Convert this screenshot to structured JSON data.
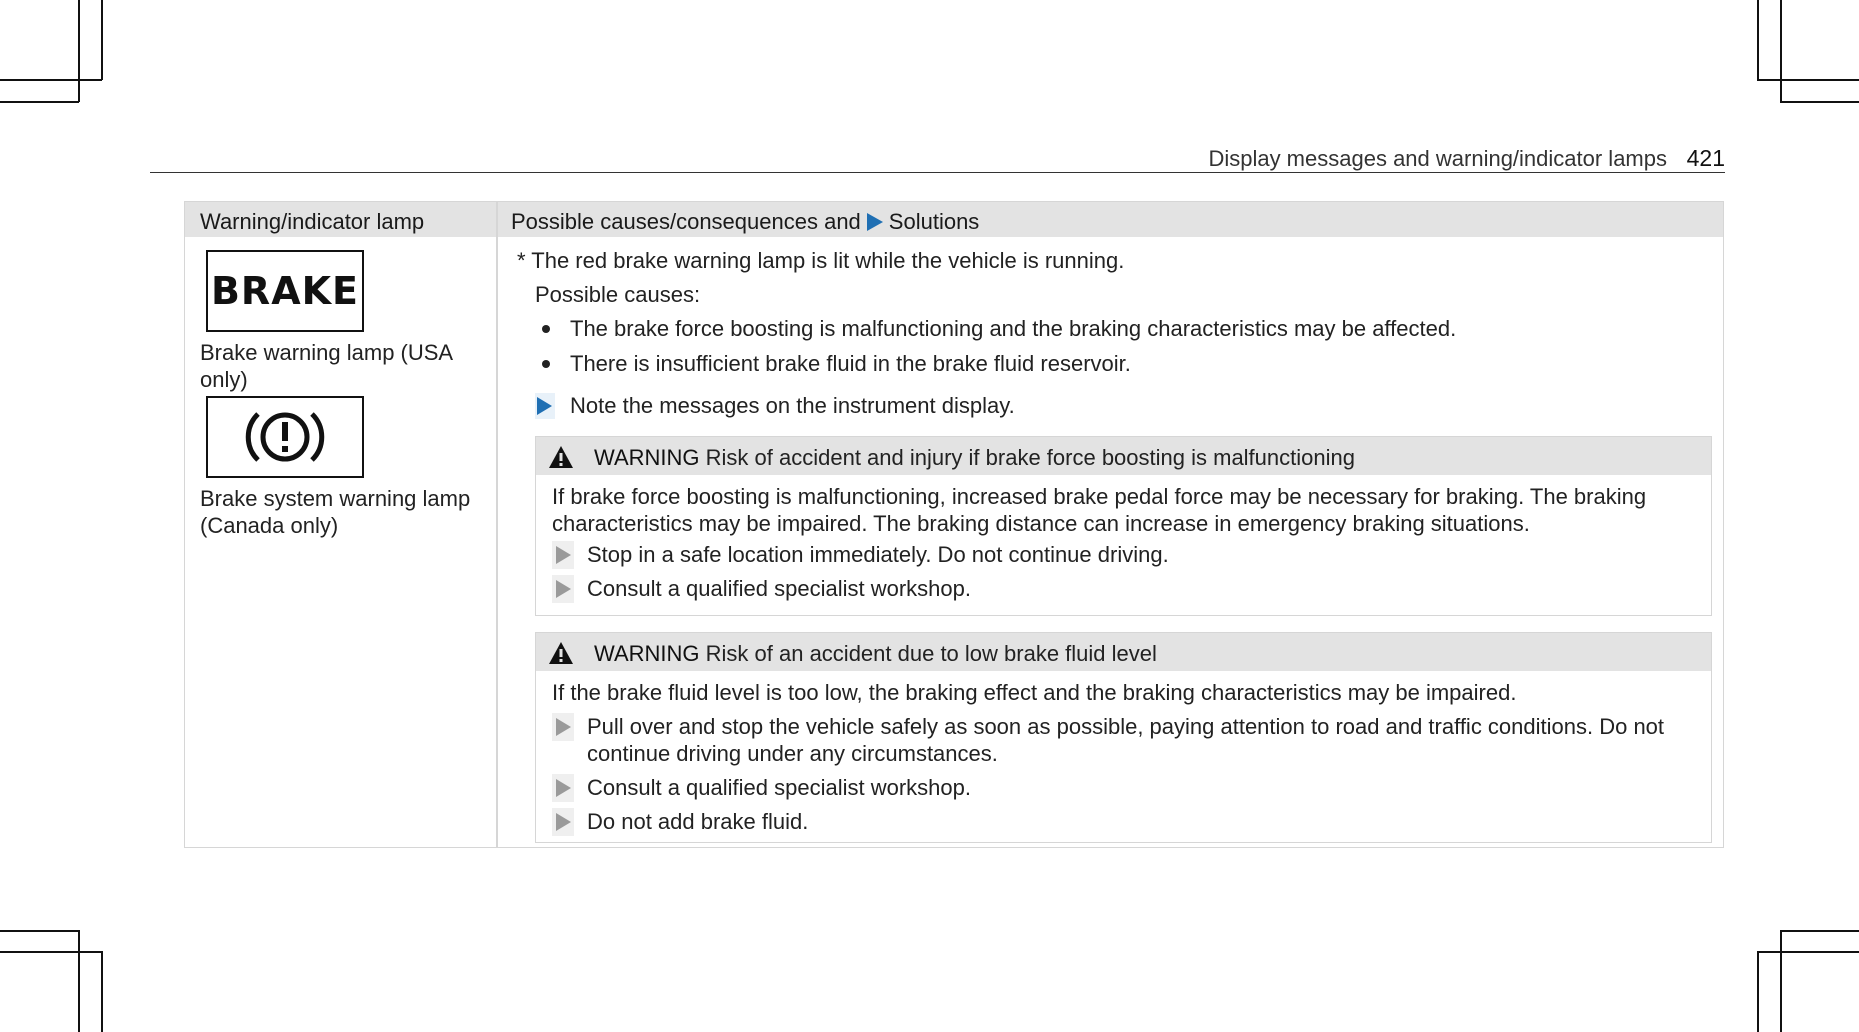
{
  "header": {
    "title": "Display messages and warning/indicator lamps",
    "page_number": "421"
  },
  "table": {
    "col1_header": "Warning/indicator lamp",
    "col2_header_a": "Possible causes/consequences and",
    "col2_header_b": "Solutions",
    "lamps": [
      {
        "symbol_text": "BRAKE",
        "caption": "Brake warning lamp (USA only)"
      },
      {
        "symbol_name": "brake-system-warning-symbol",
        "caption": "Brake system warning lamp (Canada only)"
      }
    ],
    "intro": "* The red brake warning lamp is lit while the vehicle is running.",
    "causes_label": "Possible causes:",
    "causes": [
      "The brake force boosting is malfunctioning and the braking characteristics may be affected.",
      "There is insufficient brake fluid in the brake fluid reservoir."
    ],
    "step": "Note the messages on the instrument display.",
    "warnings": [
      {
        "label": "WARNING",
        "title": "Risk of accident and injury if brake force boosting is malfunctioning",
        "text": "If brake force boosting is malfunctioning, increased brake pedal force may be necessary for braking. The braking characteristics may be impaired. The braking distance can increase in emergency braking situations.",
        "steps": [
          "Stop in a safe location immediately. Do not continue driving.",
          "Consult a qualified specialist workshop."
        ]
      },
      {
        "label": "WARNING",
        "title": "Risk of an accident due to low brake fluid level",
        "text": "If the brake fluid level is too low, the braking effect and the braking characteristics may be impaired.",
        "steps": [
          "Pull over and stop the vehicle safely as soon as possible, paying attention to road and traffic conditions. Do not continue driving under any circumstances.",
          "Consult a qualified specialist workshop.",
          "Do not add brake fluid."
        ]
      }
    ]
  },
  "colors": {
    "accent": "#1f6fb3",
    "header_bg": "#e3e3e3",
    "border": "#d6d6d6"
  }
}
